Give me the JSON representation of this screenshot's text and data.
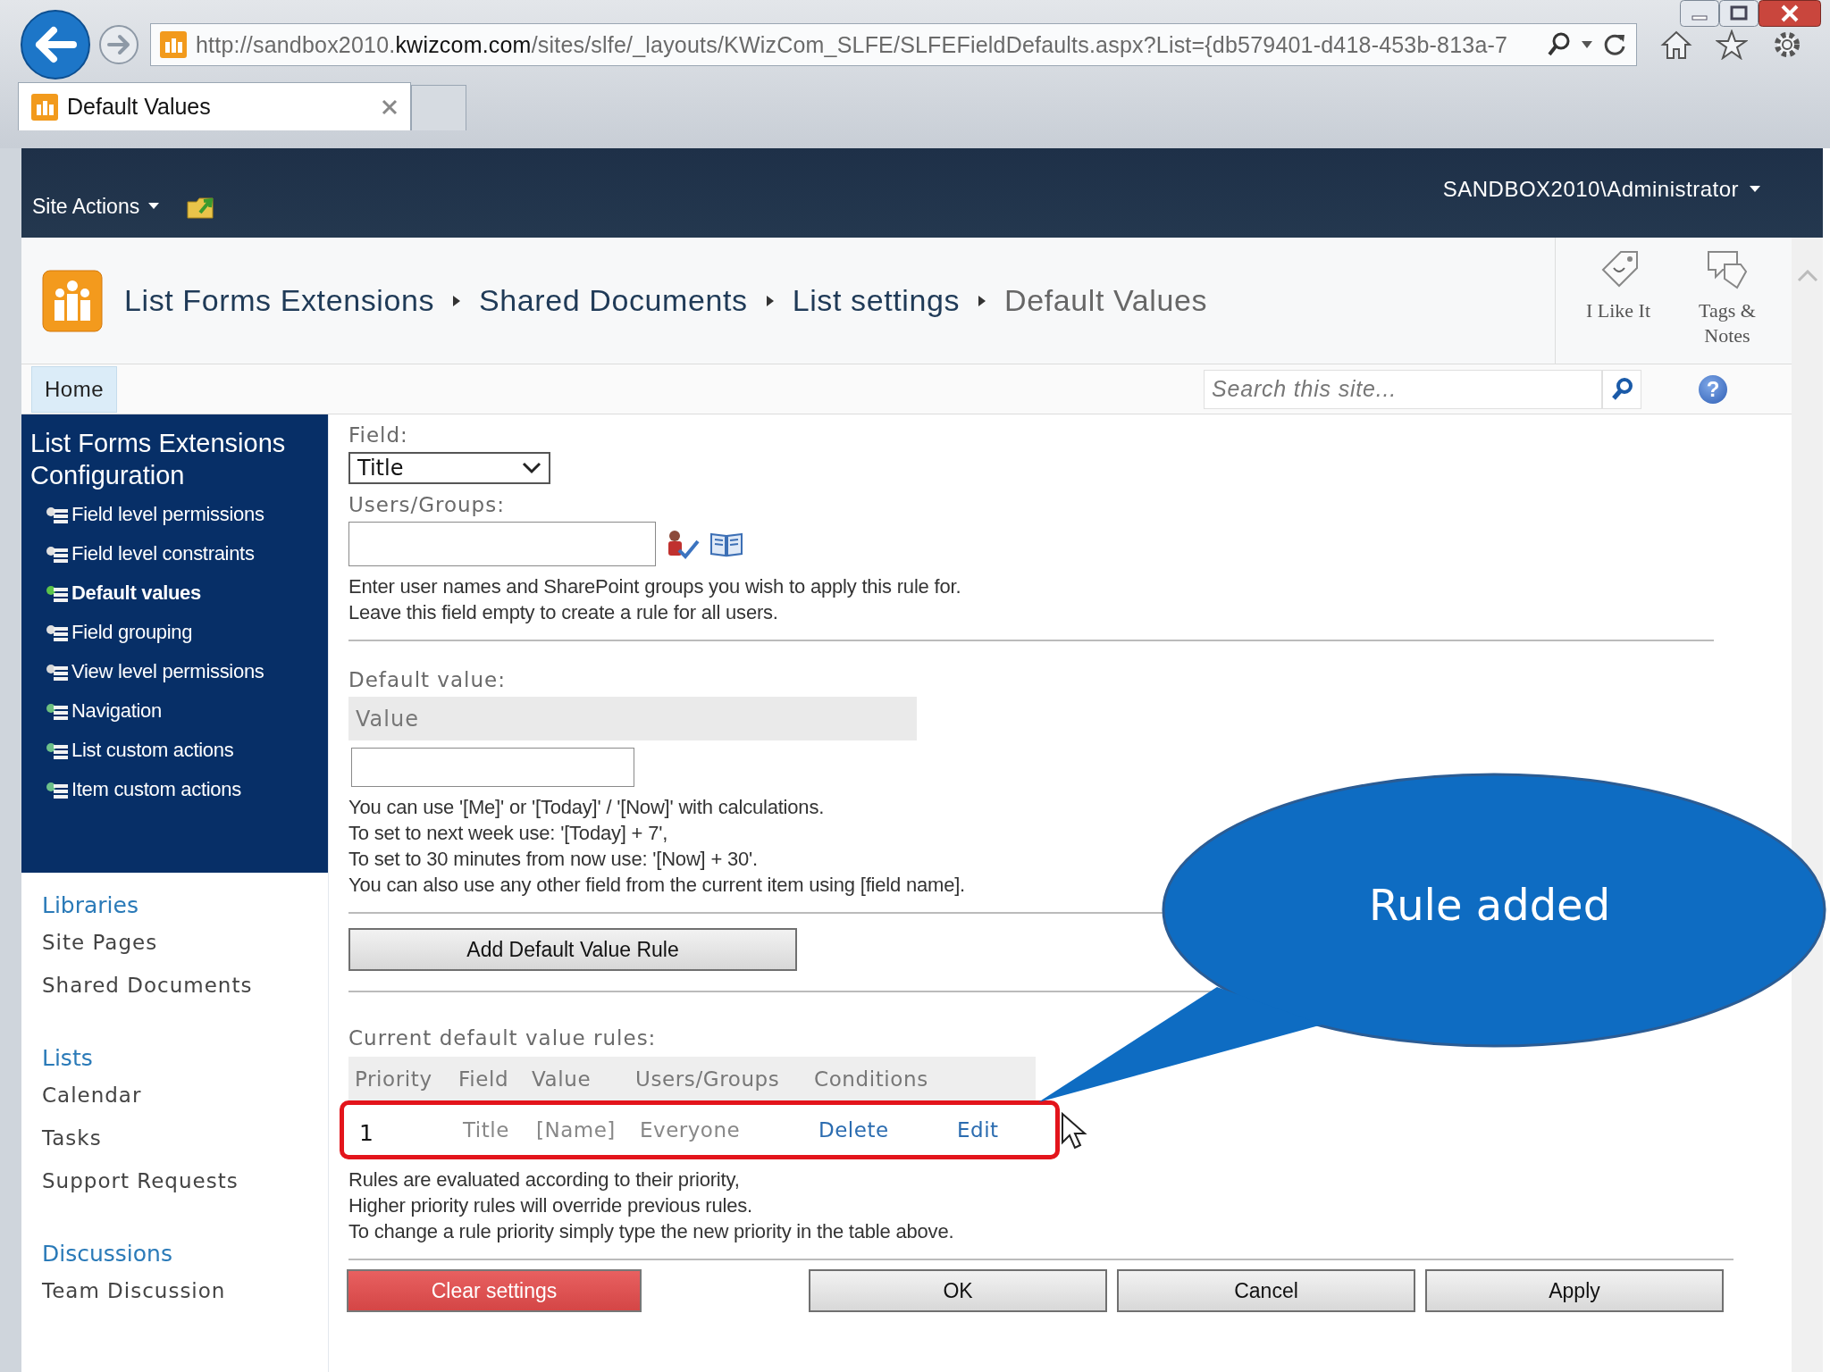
{
  "browser": {
    "address": "http://sandbox2010.**kwizcom.com**/sites/slfe/_layouts/KWizCom_SLFE/SLFEFieldDefaults.aspx?List={db579401-d418-453b-813a-7",
    "tabs": [
      {
        "label": "Default Values",
        "selected": true
      }
    ]
  },
  "ribbon": {
    "site_actions": "Site Actions",
    "user": "SANDBOX2010\\Administrator"
  },
  "breadcrumb": [
    "List Forms Extensions",
    "Shared Documents",
    "List settings",
    "Default Values"
  ],
  "social": [
    {
      "label": "I Like It",
      "kind": "like"
    },
    {
      "label": "Tags & Notes",
      "kind": "tags"
    }
  ],
  "top_nav": [
    {
      "label": "Home",
      "selected": true
    }
  ],
  "search": {
    "placeholder": "Search this site...",
    "help": "?"
  },
  "config_nav": {
    "title": "List Forms Extensions Configuration",
    "items": [
      {
        "label": "Field level permissions",
        "selected": false
      },
      {
        "label": "Field level constraints",
        "selected": false
      },
      {
        "label": "Default values",
        "selected": true
      },
      {
        "label": "Field grouping",
        "selected": false
      },
      {
        "label": "View level permissions",
        "selected": false
      },
      {
        "label": "Navigation",
        "selected": false
      },
      {
        "label": "List custom actions",
        "selected": false
      },
      {
        "label": "Item custom actions",
        "selected": false
      }
    ]
  },
  "quick_launch": [
    {
      "heading": "Libraries",
      "items": [
        "Site Pages",
        "Shared Documents"
      ]
    },
    {
      "heading": "Lists",
      "items": [
        "Calendar",
        "Tasks",
        "Support Requests"
      ]
    },
    {
      "heading": "Discussions",
      "items": [
        "Team Discussion"
      ]
    }
  ],
  "form": {
    "field_label": "Field:",
    "field_value": "Title",
    "users_label": "Users/Groups:",
    "users_help": "Enter user names and SharePoint groups you wish to apply this rule for.\nLeave this field empty to create a rule for all users.",
    "default_label": "Default value:",
    "value_header": "Value",
    "value_help": "You can use '[Me]' or '[Today]' / '[Now]' with calculations.\nTo set to next week use: '[Today] + 7',\nTo set to 30 minutes from now use: '[Now] + 30'.\n You can also use any other field from the current item using [field name].",
    "add_button": "Add Default Value Rule",
    "rules_label": "Current default value rules:",
    "rules_columns": [
      "Priority",
      "Field",
      "Value",
      "Users/Groups",
      "Conditions"
    ],
    "rules_rows": [
      {
        "priority": "1",
        "field": "Title",
        "value": "[Name]",
        "users": "Everyone",
        "actions": [
          "Delete",
          "Edit"
        ],
        "highlighted": true
      }
    ],
    "rules_help": "Rules are evaluated according to their priority,\nHigher priority rules will override previous rules.\nTo change a rule priority simply type the new priority in the table above.",
    "buttons": [
      {
        "label": "Clear settings",
        "kind": "danger"
      },
      {
        "label": "OK",
        "kind": "normal"
      },
      {
        "label": "Cancel",
        "kind": "normal"
      },
      {
        "label": "Apply",
        "kind": "normal"
      }
    ]
  },
  "callout": {
    "text": "Rule added"
  }
}
